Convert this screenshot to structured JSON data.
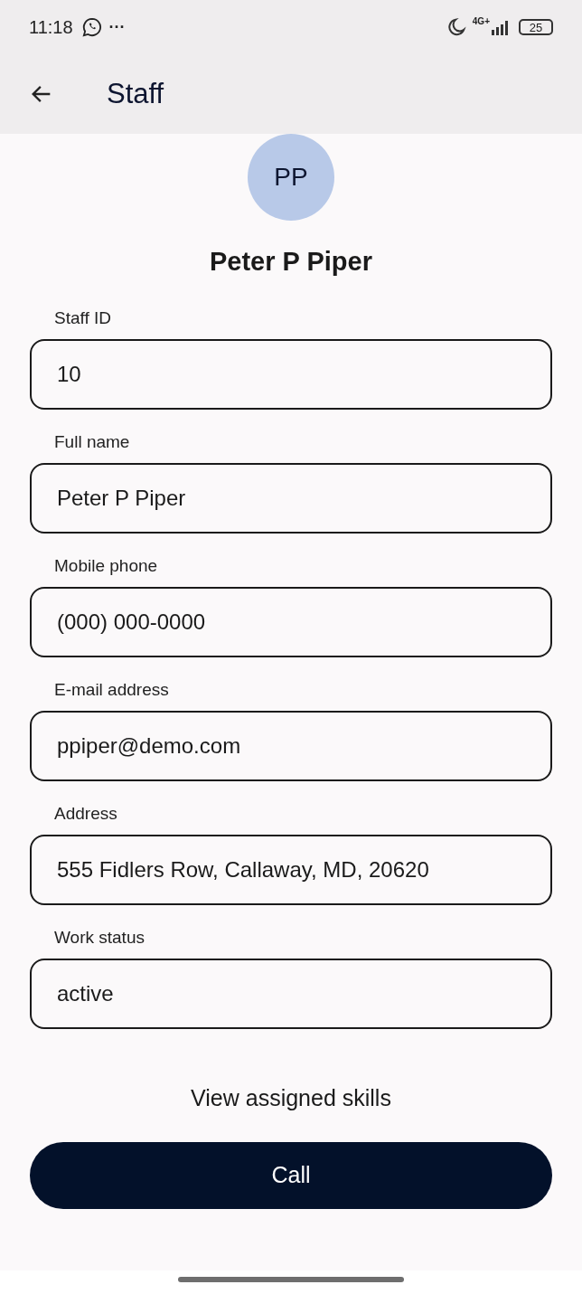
{
  "status_bar": {
    "time": "11:18",
    "more": "···",
    "network": "4G+",
    "battery": "25"
  },
  "app_bar": {
    "title": "Staff"
  },
  "profile": {
    "initials": "PP",
    "name": "Peter P Piper"
  },
  "fields": [
    {
      "label": "Staff ID",
      "value": "10"
    },
    {
      "label": "Full name",
      "value": "Peter P Piper"
    },
    {
      "label": "Mobile phone",
      "value": "(000) 000-0000"
    },
    {
      "label": "E-mail address",
      "value": "ppiper@demo.com"
    },
    {
      "label": "Address",
      "value": "555 Fidlers Row, Callaway, MD, 20620"
    },
    {
      "label": "Work status",
      "value": "active"
    }
  ],
  "link": "View assigned skills",
  "button": "Call"
}
